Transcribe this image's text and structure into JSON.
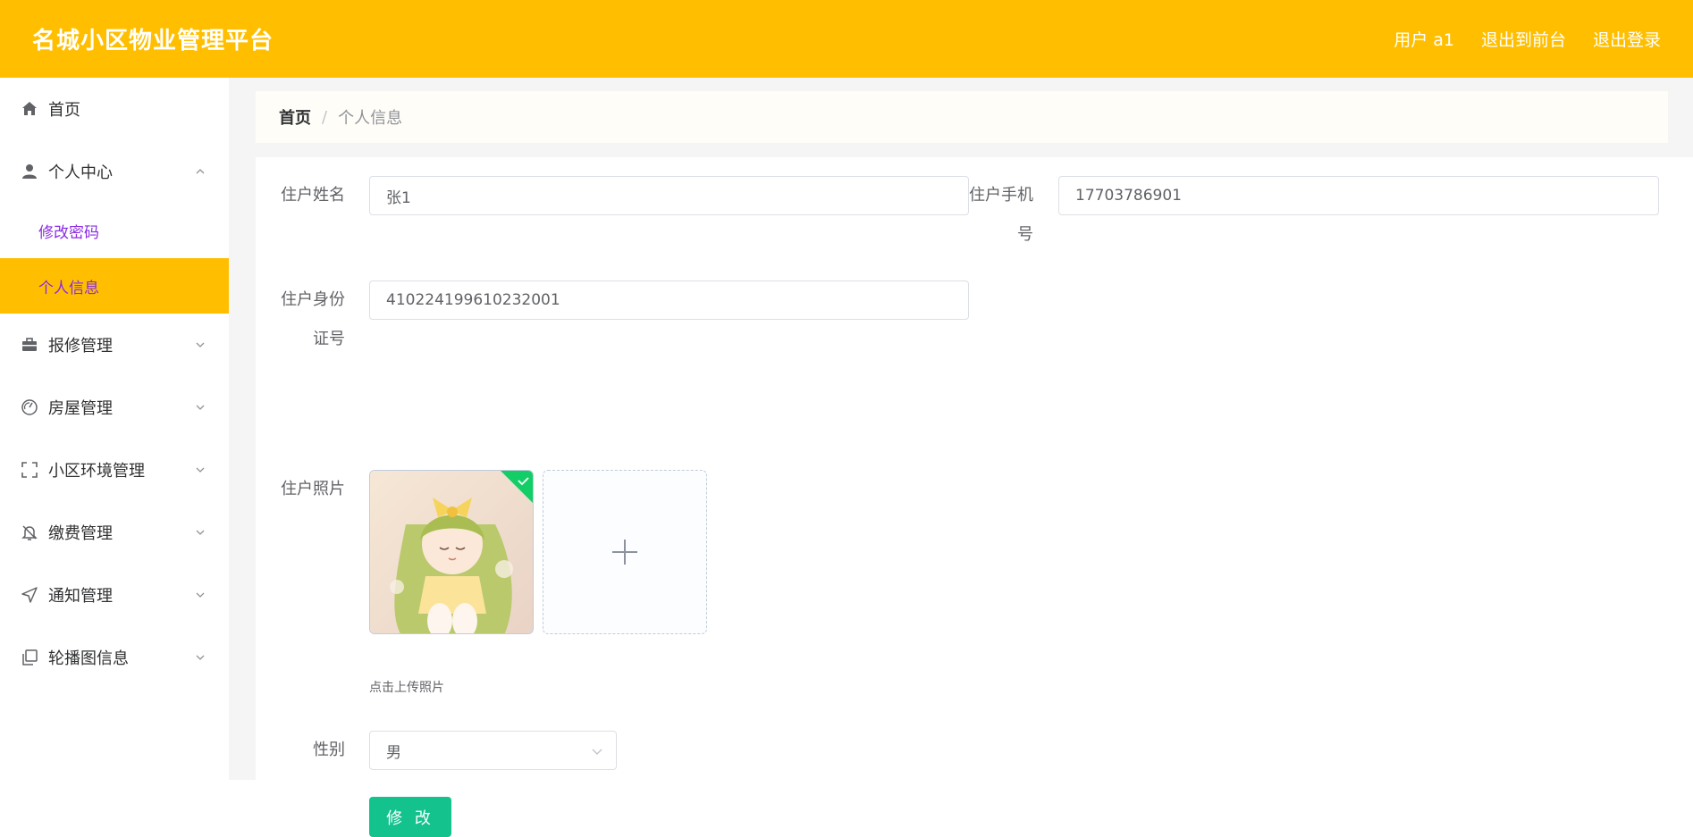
{
  "header": {
    "title": "名城小区物业管理平台",
    "user_label": "用户 a1",
    "front_link": "退出到前台",
    "logout_link": "退出登录",
    "bg_color": "#ffbf00"
  },
  "sidebar": {
    "items": [
      {
        "label": "首页",
        "icon": "home-icon"
      },
      {
        "label": "个人中心",
        "icon": "user-icon",
        "expanded": true,
        "children": [
          {
            "label": "修改密码",
            "active": false
          },
          {
            "label": "个人信息",
            "active": true
          }
        ]
      },
      {
        "label": "报修管理",
        "icon": "briefcase-icon"
      },
      {
        "label": "房屋管理",
        "icon": "gauge-icon"
      },
      {
        "label": "小区环境管理",
        "icon": "fullscreen-icon"
      },
      {
        "label": "缴费管理",
        "icon": "bell-off-icon"
      },
      {
        "label": "通知管理",
        "icon": "send-icon"
      },
      {
        "label": "轮播图信息",
        "icon": "copy-icon"
      }
    ]
  },
  "breadcrumb": {
    "home": "首页",
    "separator": "/",
    "current": "个人信息"
  },
  "form": {
    "name_label": "住户姓名",
    "name_value": "张1",
    "phone_label_1": "住户手机",
    "phone_label_2": "号",
    "phone_value": "17703786901",
    "id_label_1": "住户身份",
    "id_label_2": "证号",
    "id_value": "410224199610232001",
    "photo_label": "住户照片",
    "upload_tip": "点击上传照片",
    "gender_label": "性别",
    "gender_value": "男",
    "submit_label": "修 改",
    "submit_color": "#13c28d"
  }
}
